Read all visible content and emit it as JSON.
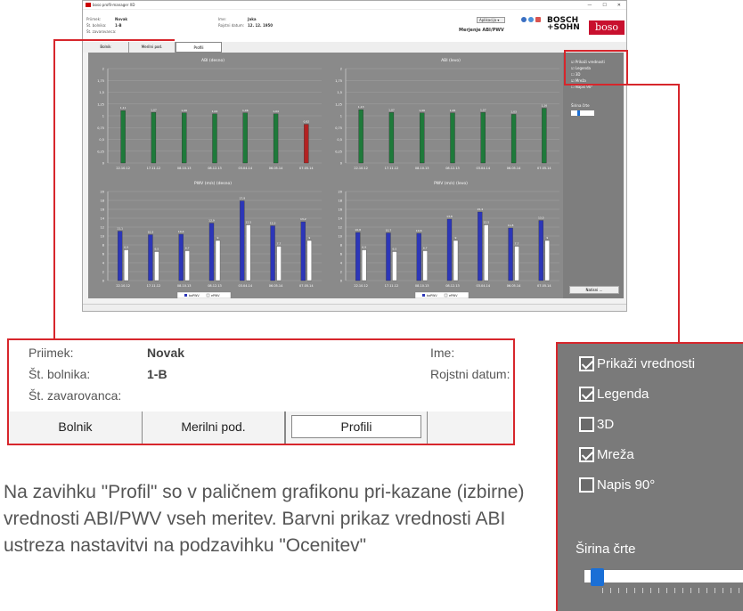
{
  "window": {
    "title": "boso profil-manager XD",
    "controls": [
      "—",
      "☐",
      "✕"
    ]
  },
  "header": {
    "surname_label": "Priimek:",
    "surname": "Novak",
    "id_label": "Št. bolnika:",
    "id": "1-B",
    "insurance_label": "Št. zavarovanca:",
    "name_label": "Ime:",
    "name": "Jaka",
    "dob_label": "Rojstni datum:",
    "dob": "12. 12. 1950",
    "app_menu": "Aplikacija",
    "mode_title": "Merjenje ABI/PWV",
    "brand": {
      "bosch": "BOSCH\n+SOHN",
      "boso": "boso"
    }
  },
  "tabs": [
    "Bolnik",
    "Merilni pod.",
    "Profili"
  ],
  "active_tab": "Profili",
  "options": {
    "items": [
      "Prikaži vrednosti",
      "Legenda",
      "3D",
      "Mreža",
      "Napis 90°"
    ],
    "checked": [
      true,
      true,
      false,
      true,
      false
    ],
    "line_width_label": "Širina črte",
    "line_width_level": 0.3,
    "print_button": "Natisni ..."
  },
  "colors": {
    "green": "#1e7a3a",
    "red": "#b22222",
    "blue": "#2c36b8",
    "white": "#ffffff",
    "accent": "#d7262c"
  },
  "chart_data": [
    {
      "type": "bar",
      "title": "ABI (desno)",
      "categories": [
        "22.10.12",
        "17.11.12",
        "08.10.13",
        "08.12.13",
        "03.04.14",
        "06.05.14",
        "07.05.14"
      ],
      "values": [
        1.11,
        1.07,
        1.06,
        1.04,
        1.06,
        1.04,
        0.82
      ],
      "value_labels": [
        "1,11",
        "1,07",
        "1,06",
        "1,04",
        "1,06",
        "1,04",
        "0,82"
      ],
      "yticks": [
        "0",
        "0,25",
        "0,5",
        "0,75",
        "1",
        "1,25",
        "1,5",
        "1,75",
        "2"
      ],
      "ylim": [
        0,
        2
      ],
      "bar_colors": [
        "green",
        "green",
        "green",
        "green",
        "green",
        "green",
        "red"
      ]
    },
    {
      "type": "bar",
      "title": "ABI (levo)",
      "categories": [
        "22.10.12",
        "17.11.12",
        "08.10.13",
        "08.12.13",
        "03.04.14",
        "06.05.14",
        "07.05.14"
      ],
      "values": [
        1.13,
        1.07,
        1.06,
        1.06,
        1.07,
        1.03,
        1.16
      ],
      "value_labels": [
        "1,13",
        "1,07",
        "1,06",
        "1,06",
        "1,07",
        "1,03",
        "1,16"
      ],
      "yticks": [
        "0",
        "0,25",
        "0,5",
        "0,75",
        "1",
        "1,25",
        "1,5",
        "1,75",
        "2"
      ],
      "ylim": [
        0,
        2
      ],
      "bar_colors": [
        "green",
        "green",
        "green",
        "green",
        "green",
        "green",
        "green"
      ]
    },
    {
      "type": "bar",
      "title": "PWV (m/s) (desno)",
      "categories": [
        "22.10.12",
        "17.11.12",
        "08.10.13",
        "08.12.13",
        "03.04.14",
        "06.05.14",
        "07.05.14"
      ],
      "series": [
        {
          "name": "baPWV",
          "values": [
            11.1,
            10.3,
            10.4,
            12.9,
            17.9,
            12.3,
            13.2
          ]
        },
        {
          "name": "ePWV",
          "values": [
            6.9,
            6.5,
            6.7,
            9.0,
            12.5,
            7.7,
            9.0
          ]
        }
      ],
      "yticks": [
        "0",
        "2",
        "4",
        "6",
        "8",
        "10",
        "12",
        "14",
        "16",
        "18",
        "20"
      ],
      "ylim": [
        0,
        20
      ],
      "legend": "bottom"
    },
    {
      "type": "bar",
      "title": "PWV (m/s) (levo)",
      "categories": [
        "22.10.12",
        "17.11.12",
        "08.10.13",
        "08.12.13",
        "03.04.14",
        "06.05.14",
        "07.05.14"
      ],
      "series": [
        {
          "name": "baPWV",
          "values": [
            10.8,
            10.7,
            10.6,
            13.8,
            15.4,
            11.8,
            13.5
          ]
        },
        {
          "name": "ePWV",
          "values": [
            6.9,
            6.5,
            6.7,
            9.0,
            12.5,
            7.7,
            9.0
          ]
        }
      ],
      "yticks": [
        "0",
        "2",
        "4",
        "6",
        "8",
        "10",
        "12",
        "14",
        "16",
        "18",
        "20"
      ],
      "ylim": [
        0,
        20
      ],
      "legend": "bottom"
    }
  ],
  "caption": "Na zavihku \"Profil\" so v paličnem grafikonu pri-kazane (izbirne) vrednosti ABI/PWV vseh meritev. Barvni prikaz vrednosti ABI ustreza nastavitvi na podzavihku \"Ocenitev\""
}
